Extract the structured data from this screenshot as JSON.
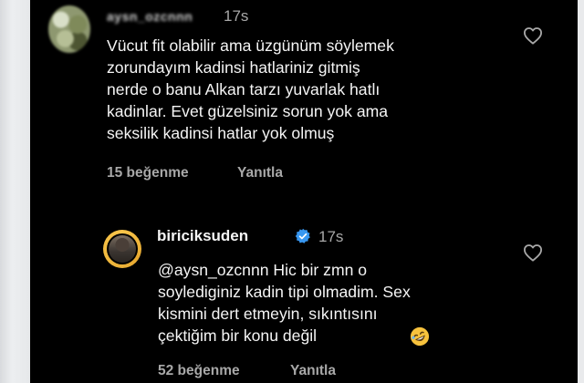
{
  "comment": {
    "username": "aysn_ozcnnn",
    "time": "17s",
    "text": "Vücut fit olabilir ama üzgünüm söylemek\nzorundayım kadinsi hatlariniz gitmiş\nnerde o banu Alkan tarzı yuvarlak hatlı\nkadinlar. Evet güzelsiniz sorun yok ama\nseksilik kadinsi hatlar yok olmuş",
    "likes": "15 beğenme",
    "reply_label": "Yanıtla"
  },
  "reply": {
    "username": "biriciksuden",
    "time": "17s",
    "text": "@aysn_ozcnnn Hic bir zmn o\nsoylediginiz kadin tipi olmadim. Sex\nkismini dert etmeyin, sıkıntısını\nçektiğim bir konu değil",
    "emoji": "rolling-on-floor-laughing-emoji",
    "likes": "52 beğenme",
    "reply_label": "Yanıtla"
  },
  "icons": {
    "like": "heart-outline-icon",
    "verified": "verified-badge-icon"
  },
  "colors": {
    "background": "#000000",
    "text": "#f5f5f5",
    "secondary": "#a8a8a8",
    "verified": "#3897f0",
    "story_ring": "#f9c54a"
  }
}
